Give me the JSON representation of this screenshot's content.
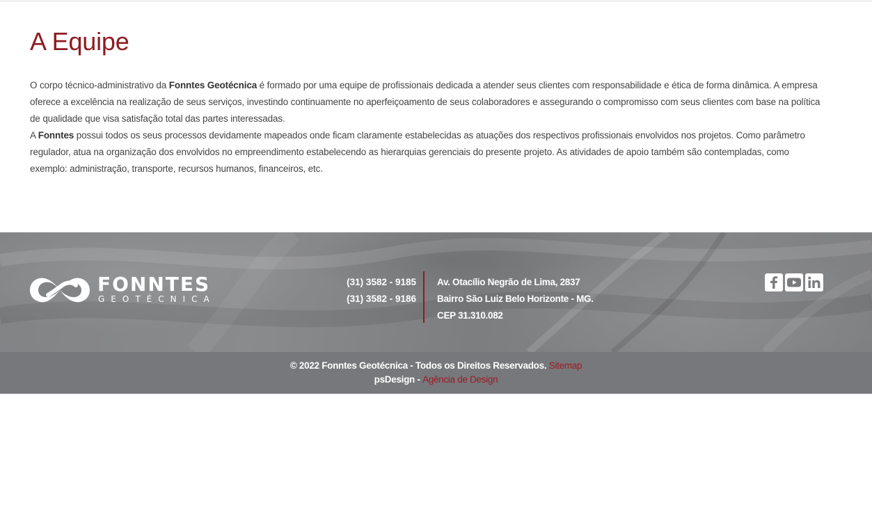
{
  "page": {
    "title": "A Equipe"
  },
  "content": {
    "p1_prefix": "O corpo técnico-administrativo da ",
    "p1_bold": "Fonntes Geotécnica",
    "p1_suffix": " é formado por uma equipe de profissionais dedicada a atender seus clientes com responsabilidade e ética de forma dinâmica. A empresa oferece a excelência na realização de seus serviços, investindo continuamente no aperfeiçoamento de seus colaboradores e assegurando o compromisso com seus clientes com base na política de qualidade que visa satisfação total das partes interessadas.",
    "p2_prefix": "A ",
    "p2_bold": "Fonntes",
    "p2_suffix": " possui todos os seus processos devidamente mapeados onde ficam claramente estabelecidas as atuações dos respectivos profissionais envolvidos nos projetos. Como parâmetro regulador, atua na organização dos envolvidos no empreendimento estabelecendo as hierarquias gerenciais do presente projeto. As atividades de apoio também são contempladas, como exemplo: administração, transporte, recursos humanos, financeiros, etc."
  },
  "footer": {
    "logo_word": "FONNTES",
    "logo_sub": "GEOTÉCNICA",
    "phones": [
      "(31) 3582 - 9185",
      "(31) 3582 - 9186"
    ],
    "address": [
      "Av. Otacílio Negrão de Lima, 2837",
      "Bairro São Luiz Belo Horizonte - MG.",
      "CEP 31.310.082"
    ],
    "social": [
      {
        "name": "facebook",
        "icon": "facebook-icon"
      },
      {
        "name": "youtube",
        "icon": "youtube-icon"
      },
      {
        "name": "linkedin",
        "icon": "linkedin-icon"
      }
    ],
    "copyright": "© 2022 Fonntes Geotécnica - Todos os Direitos Reservados. ",
    "sitemap_label": "Sitemap",
    "credit_prefix": "psDesign - ",
    "credit_link": "Agência de Design"
  },
  "colors": {
    "accent": "#8e1b22",
    "footer": "#7a7b7d",
    "text": "#444444"
  }
}
